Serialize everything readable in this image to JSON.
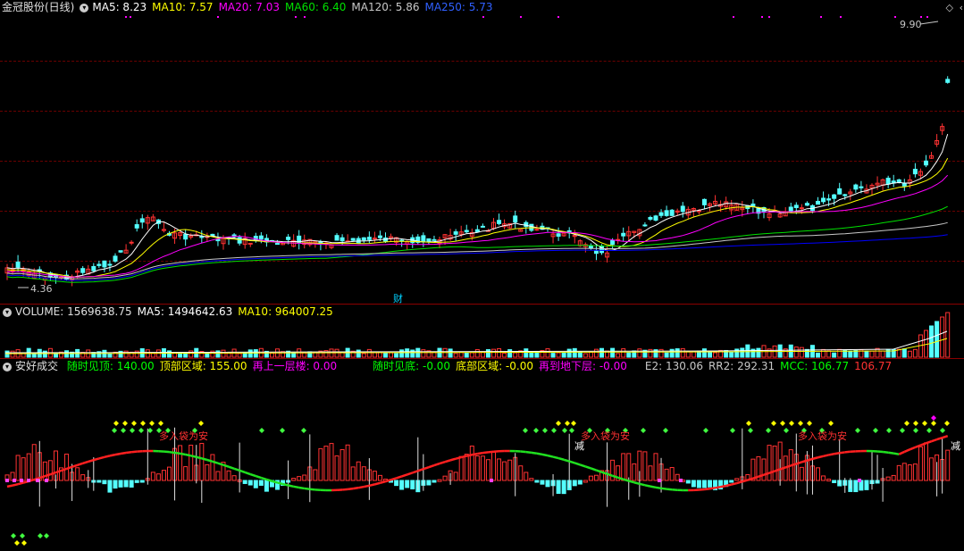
{
  "main": {
    "title": "金冠股份(日线)",
    "ma5_label": "MA5: 8.23",
    "ma10_label": "MA10: 7.57",
    "ma20_label": "MA20: 7.03",
    "ma60_label": "MA60: 6.40",
    "ma120_label": "MA120: 5.86",
    "ma250_label": "MA250: 5.73",
    "high_label": "9.90",
    "low_label": "4.36",
    "fin_marker": "财",
    "colors": {
      "ma5": "#ffffff",
      "ma10": "#ffff00",
      "ma20": "#ff00ff",
      "ma60": "#00e000",
      "ma120": "#c8c8c8",
      "ma250": "#0000ff",
      "up": "#ff3232",
      "down": "#54ffff"
    }
  },
  "volume": {
    "label": "VOLUME: 1569638.75",
    "ma5_label": "MA5: 1494642.63",
    "ma10_label": "MA10: 964007.25"
  },
  "indicator": {
    "name": "安好成交",
    "items": [
      {
        "text": "随时见顶: 140.00",
        "color": "#00ff00"
      },
      {
        "text": "顶部区域: 155.00",
        "color": "#ffff00"
      },
      {
        "text": "再上一层楼: 0.00",
        "color": "#ff00ff"
      },
      {
        "text": "随时见底: -0.00",
        "color": "#00ff00"
      },
      {
        "text": "底部区域: -0.00",
        "color": "#ffff00"
      },
      {
        "text": "再到地下层: -0.00",
        "color": "#ff00ff"
      },
      {
        "text": "E2: 130.06",
        "color": "#c8c8c8"
      },
      {
        "text": "RR2: 292.31",
        "color": "#c8c8c8"
      },
      {
        "text": "MCC: 106.77",
        "color": "#00ff00"
      },
      {
        "text": "106.77",
        "color": "#ff3232"
      }
    ],
    "annotations": [
      {
        "text": "多入袋为安"
      },
      {
        "text": "多入袋为安"
      },
      {
        "text": "多入袋为安"
      },
      {
        "text": "减"
      },
      {
        "text": "减"
      }
    ]
  }
}
